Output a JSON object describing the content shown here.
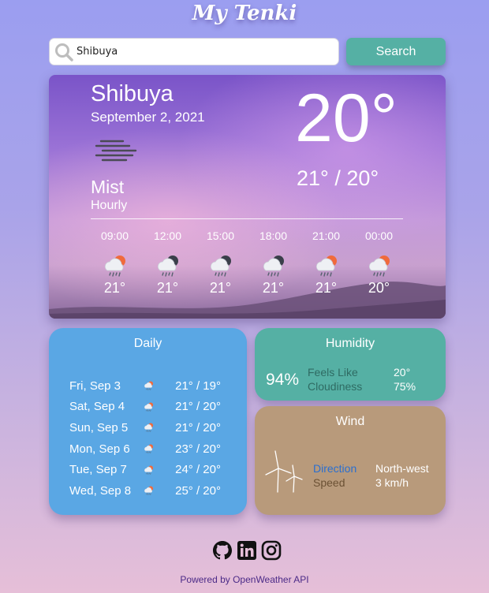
{
  "app": {
    "title": "My Tenki"
  },
  "search": {
    "value": "Shibuya",
    "button_label": "Search"
  },
  "current": {
    "city": "Shibuya",
    "date": "September 2, 2021",
    "condition": "Mist",
    "icon": "mist-icon",
    "hourly_label": "Hourly",
    "temperature": "20°",
    "temp_range": "21° / 20°"
  },
  "hourly": [
    {
      "time": "09:00",
      "temp": "21°",
      "icon": "rain-sun-icon"
    },
    {
      "time": "12:00",
      "temp": "21°",
      "icon": "rain-night-icon"
    },
    {
      "time": "15:00",
      "temp": "21°",
      "icon": "rain-night-icon"
    },
    {
      "time": "18:00",
      "temp": "21°",
      "icon": "rain-night-icon"
    },
    {
      "time": "21:00",
      "temp": "21°",
      "icon": "rain-sun-icon"
    },
    {
      "time": "00:00",
      "temp": "20°",
      "icon": "rain-sun-icon"
    }
  ],
  "daily": {
    "title": "Daily",
    "days": [
      {
        "day": "Fri, Sep 3",
        "range": "21° / 19°",
        "icon": "rain-sun-icon"
      },
      {
        "day": "Sat, Sep 4",
        "range": "21° / 20°",
        "icon": "rain-sun-icon"
      },
      {
        "day": "Sun, Sep 5",
        "range": "21° / 20°",
        "icon": "rain-sun-icon"
      },
      {
        "day": "Mon, Sep 6",
        "range": "23° / 20°",
        "icon": "rain-sun-icon"
      },
      {
        "day": "Tue, Sep 7",
        "range": "24° / 20°",
        "icon": "rain-sun-icon"
      },
      {
        "day": "Wed, Sep 8",
        "range": "25° / 20°",
        "icon": "rain-sun-icon"
      }
    ]
  },
  "humidity": {
    "title": "Humidity",
    "value": "94%",
    "feels_like_label": "Feels Like",
    "feels_like_value": "20°",
    "cloudiness_label": "Cloudiness",
    "cloudiness_value": "75%"
  },
  "wind": {
    "title": "Wind",
    "direction_label": "Direction",
    "direction_value": "North-west",
    "speed_label": "Speed",
    "speed_value": "3 km/h",
    "icon": "wind-turbine-icon"
  },
  "footer": {
    "social_icons": [
      "github-icon",
      "linkedin-icon",
      "instagram-icon"
    ],
    "powered_by": "Powered by OpenWeather API"
  },
  "colors": {
    "search_button": "#55b0a4",
    "daily_card": "#5aa7e4",
    "humidity_card": "#55b0a4",
    "wind_card": "#b89a7b",
    "footer_text": "#4b2a87"
  }
}
